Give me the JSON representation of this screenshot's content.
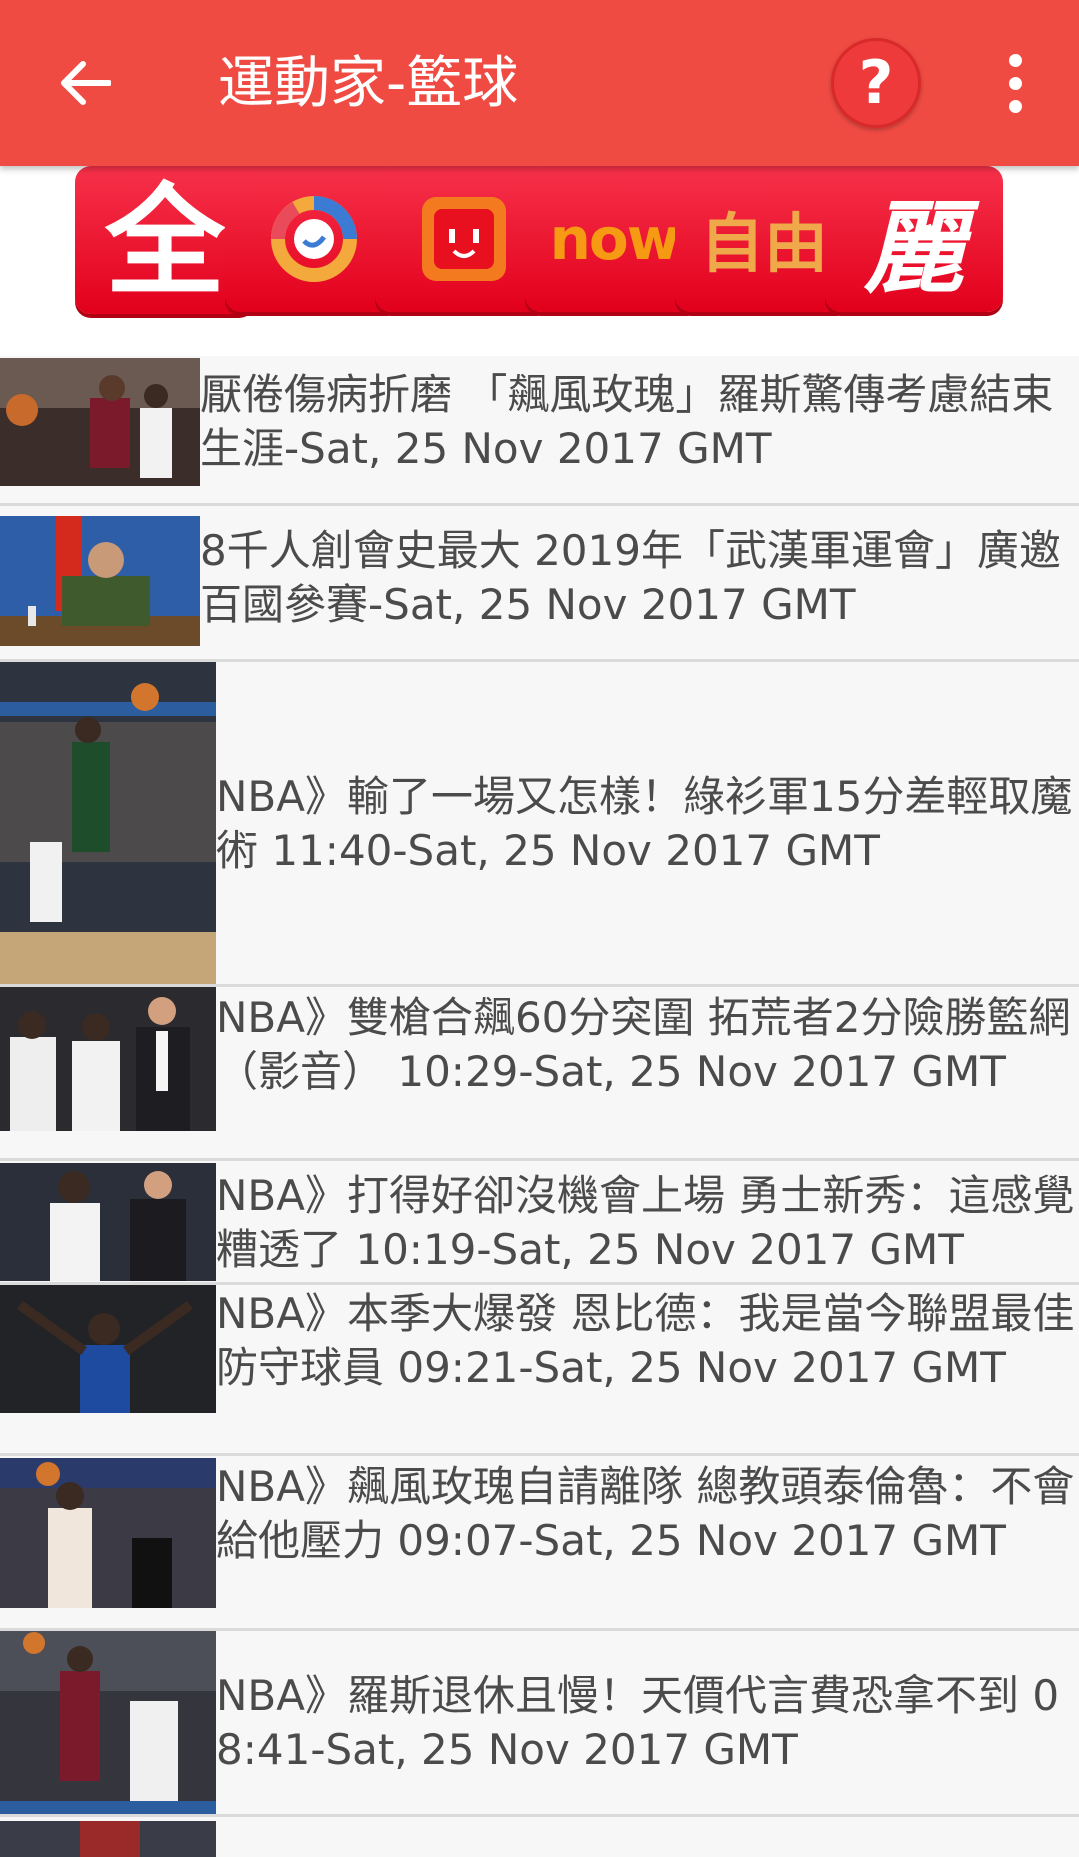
{
  "appbar": {
    "title": "運動家-籃球",
    "back_icon": "arrow-left-icon",
    "help_icon": "help-circle-icon",
    "help_label": "?",
    "more_icon": "more-vertical-icon",
    "color": "#ef4b43"
  },
  "logos": [
    {
      "name": "全",
      "label": "全"
    },
    {
      "name": "circle-logo-icon",
      "label": ""
    },
    {
      "name": "face-logo-icon",
      "label": ""
    },
    {
      "name": "now",
      "label": "now"
    },
    {
      "name": "自由",
      "label": "自由"
    },
    {
      "name": "麗",
      "label": "麗"
    }
  ],
  "news": [
    {
      "title": "厭倦傷病折磨 「飆風玫瑰」羅斯驚傳考慮結束生涯-Sat, 25 Nov 2017 GMT"
    },
    {
      "title": "8千人創會史最大 2019年「武漢軍運會」廣邀百國參賽-Sat, 25 Nov 2017 GMT"
    },
    {
      "title": "NBA》輸了一場又怎樣！綠衫軍15分差輕取魔術 11:40-Sat, 25 Nov 2017 GMT"
    },
    {
      "title": "NBA》雙槍合飆60分突圍 拓荒者2分險勝籃網（影音） 10:29-Sat, 25 Nov 2017 GMT"
    },
    {
      "title": "NBA》打得好卻沒機會上場 勇士新秀：這感覺糟透了 10:19-Sat, 25 Nov 2017 GMT"
    },
    {
      "title": "NBA》本季大爆發 恩比德：我是當今聯盟最佳防守球員 09:21-Sat, 25 Nov 2017 GMT"
    },
    {
      "title": "NBA》飆風玫瑰自請離隊 總教頭泰倫魯：不會給他壓力 09:07-Sat, 25 Nov 2017 GMT"
    },
    {
      "title": "NBA》羅斯退休且慢！天價代言費恐拿不到 08:41-Sat, 25 Nov 2017 GMT"
    }
  ]
}
